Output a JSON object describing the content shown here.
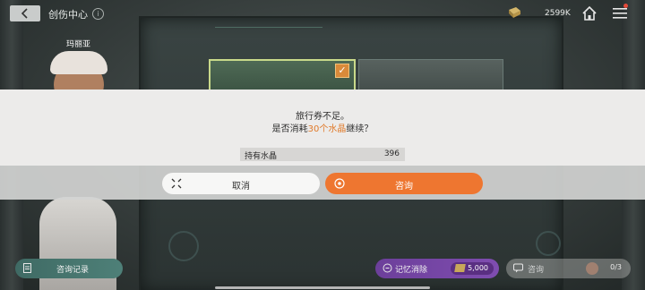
{
  "header": {
    "title": "创伤中心",
    "currency_value": "2599K"
  },
  "character": {
    "name": "玛丽亚"
  },
  "dialog": {
    "line1": "旅行券不足。",
    "line2_prefix": "是否消耗",
    "line2_highlight": "30个水晶",
    "line2_suffix": "继续？",
    "hold_label": "持有水晶",
    "hold_value": "396",
    "cancel_label": "取消",
    "confirm_label": "咨询"
  },
  "bottom": {
    "history_label": "咨询记录",
    "erase_label": "记忆消除",
    "erase_cost": "5,000",
    "consult_label": "咨询",
    "consult_count": "0/3"
  },
  "colors": {
    "accent": "#ee7630",
    "highlight_text": "#e07a2a",
    "erase_button": "#7f4db0",
    "history_button": "#4e8078"
  },
  "icons": [
    "back-arrow-icon",
    "info-icon",
    "crystal-icon",
    "home-icon",
    "menu-icon",
    "close-x-icon",
    "target-icon",
    "document-icon",
    "erase-icon",
    "chat-icon"
  ]
}
